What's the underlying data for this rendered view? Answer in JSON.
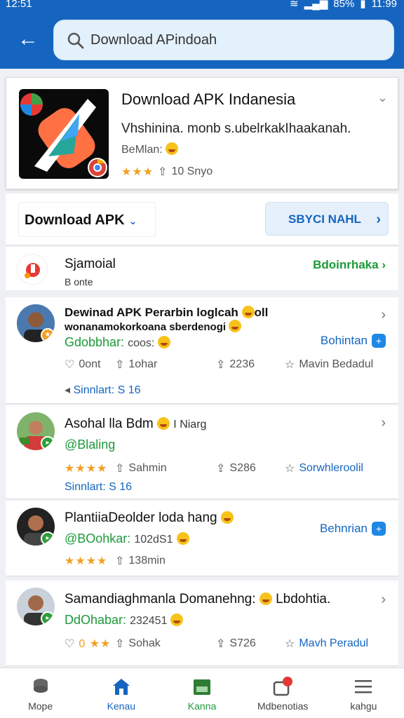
{
  "status": {
    "time": "12:51",
    "battery": "85%",
    "clock_right": "11:99"
  },
  "search": {
    "value": "Download APindoah"
  },
  "app": {
    "title": "Download APK Indanesia",
    "desc": "Vhshinina. monb s.ubelrkakIhaakanah.",
    "meta": "BeMlan:",
    "rating_text": "10 Snyo",
    "stars": "★★★"
  },
  "bar2": {
    "dropdown": "Download APK",
    "button": "SBYCI NAHL"
  },
  "suggest": {
    "title": "Sjamoial",
    "sub": "B onte",
    "link": "Bdoinrhaka"
  },
  "posts": [
    {
      "title1": "Dewinad APK Perarbin  loglcah",
      "title1b": "oll",
      "title2": "wonanamokorkoana sberdenogi",
      "handle": "Gdobbhar:",
      "handle_tail": "coos:",
      "cta": "Bohintan",
      "a1": "0ont",
      "a2": "1ohar",
      "a3": "2236",
      "a4": "Mavin Bedadul",
      "foot": "Sinnlart: S 16"
    },
    {
      "title": "Asohal lla Bdm",
      "title_tail": "I Niarg",
      "handle": "@Blaling",
      "a1": "★★★★",
      "a2": "Sahmin",
      "a3": "S286",
      "a4": "Sorwhleroolil",
      "foot": "Sinnlart: S 16"
    },
    {
      "title": "PlantiiaDeolder loda hang",
      "handle": "@BOohkar:",
      "handle_tail": "102dS1",
      "cta": "Behnrian",
      "a1": "★★★★",
      "a2": "138min"
    },
    {
      "title": "Samandiaghmanla Domanehng:",
      "title_tail": "Lbdohtia.",
      "handle": "DdOhabar:",
      "handle_tail": "232451",
      "a1": "0 ★★",
      "a2": "Sohak",
      "a3": "S726",
      "a4": "Mavh Peradul"
    }
  ],
  "nav": [
    {
      "label": "Mope",
      "icon": "stack-icon"
    },
    {
      "label": "Kenau",
      "icon": "home-icon"
    },
    {
      "label": "Kanna",
      "icon": "store-icon"
    },
    {
      "label": "Mdbenotias",
      "icon": "notifications-icon"
    },
    {
      "label": "kahgu",
      "icon": "menu-icon"
    }
  ],
  "colors": {
    "primary": "#1565c0",
    "green": "#1b9a3a",
    "star": "#f0a020"
  }
}
